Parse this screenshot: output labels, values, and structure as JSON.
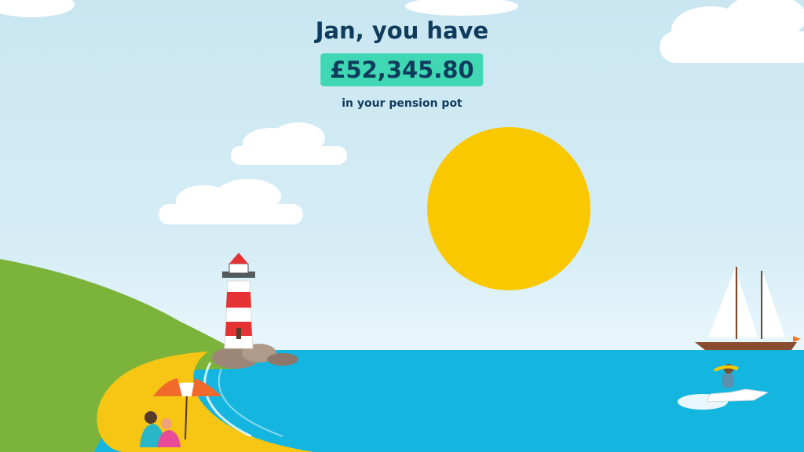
{
  "greeting": "Jan, you have",
  "pension_amount": "£52,345.80",
  "pension_label": "in your pension pot",
  "colors": {
    "sky_top": "#c9e6f1",
    "sun": "#f9c800",
    "sea": "#14b6df",
    "hill": "#7cb33a",
    "beach": "#f7c614",
    "amount_badge": "#3fd7b4",
    "text": "#0f3b5c"
  },
  "icons": [
    "sun-icon",
    "cloud-icon",
    "lighthouse-icon",
    "sailboat-icon",
    "jetski-icon",
    "beach-umbrella-icon"
  ]
}
